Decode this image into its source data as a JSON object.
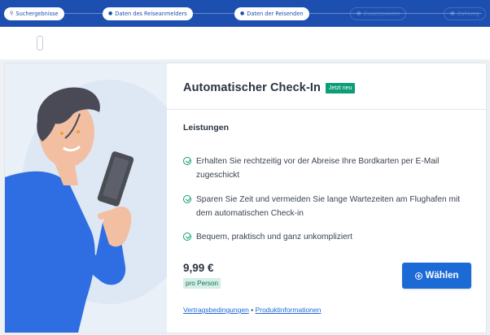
{
  "progress": {
    "steps": [
      {
        "label": "Suchergebnisse",
        "state": "done",
        "icon": "search-icon"
      },
      {
        "label": "Daten des Reiseanmelders",
        "state": "done",
        "icon": "user-icon"
      },
      {
        "label": "Daten der Reisenden",
        "state": "done",
        "icon": "users-icon"
      },
      {
        "label": "Zusatzpakete",
        "state": "future",
        "icon": "box-icon"
      },
      {
        "label": "Zahlung",
        "state": "future",
        "icon": "card-icon"
      }
    ]
  },
  "product": {
    "title": "Automatischer Check-In",
    "badge": "Jetzt neu",
    "section_label": "Leistungen",
    "benefits": [
      "Erhalten Sie rechtzeitig vor der Abreise Ihre Bordkarten per E-Mail zugeschickt",
      "Sparen Sie Zeit und vermeiden Sie lange Wartezeiten am Flughafen mit dem automatischen Check-in",
      "Bequem, praktisch und ganz unkompliziert"
    ],
    "price": "9,99 €",
    "price_unit": "pro Person",
    "choose_label": "Wählen",
    "links": {
      "terms": "Vertragsbedingungen",
      "separator": "•",
      "info": "Produktinformationen"
    }
  },
  "colors": {
    "brand_blue": "#1c4fb0",
    "accent_green": "#0d9e77",
    "button_blue": "#1c6ad6"
  }
}
